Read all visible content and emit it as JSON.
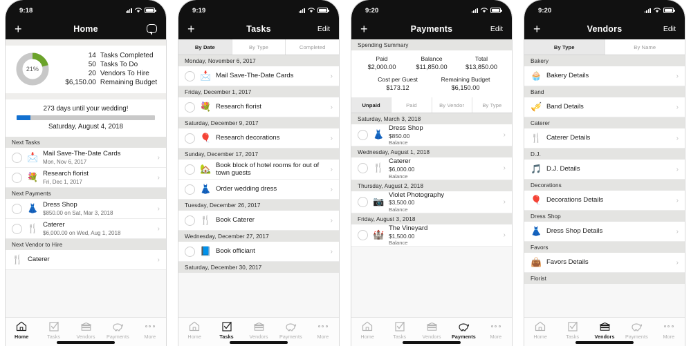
{
  "phones": [
    {
      "id": "home",
      "status": {
        "time": "9:18"
      },
      "nav": {
        "left_icon": "plus-icon",
        "title": "Home",
        "right_icon": "chat-bubble-icon"
      },
      "summary": {
        "donut_percent": "21%",
        "donut_value": 21,
        "donut_fill_color": "#6ba32a",
        "donut_track_color": "#c8c8c8",
        "stats": [
          {
            "value": "14",
            "label": "Tasks Completed"
          },
          {
            "value": "50",
            "label": "Tasks To Do"
          },
          {
            "value": "20",
            "label": "Vendors To Hire"
          },
          {
            "value": "$6,150.00",
            "label": "Remaining Budget"
          }
        ]
      },
      "countdown": {
        "title": "273 days until your wedding!",
        "progress_percent": 10,
        "progress_color": "#1270d0",
        "date": "Saturday, August 4, 2018"
      },
      "sections": [
        {
          "header": "Next Tasks",
          "rows": [
            {
              "radio": true,
              "icon": "📩",
              "icon_name": "mailbox-icon",
              "title": "Mail Save-The-Date Cards",
              "sub": "Mon, Nov 6, 2017"
            },
            {
              "radio": true,
              "icon": "💐",
              "icon_name": "bouquet-icon",
              "title": "Research florist",
              "sub": "Fri, Dec 1, 2017"
            }
          ]
        },
        {
          "header": "Next Payments",
          "rows": [
            {
              "radio": true,
              "icon": "👗",
              "icon_name": "dress-hanger-icon",
              "title": "Dress Shop",
              "sub": "$850.00 on Sat, Mar 3, 2018"
            },
            {
              "radio": true,
              "icon": "🍴",
              "icon_name": "cutlery-icon",
              "title": "Caterer",
              "sub": "$6,000.00 on Wed, Aug 1, 2018"
            }
          ]
        },
        {
          "header": "Next Vendor to Hire",
          "rows": [
            {
              "radio": false,
              "icon": "🍴",
              "icon_name": "cutlery-icon",
              "title": "Caterer",
              "sub": "",
              "clipped": true
            }
          ]
        }
      ],
      "tabbar_active": "Home"
    },
    {
      "id": "tasks",
      "status": {
        "time": "9:19"
      },
      "nav": {
        "left_icon": "plus-icon",
        "title": "Tasks",
        "right_label": "Edit"
      },
      "segments": [
        {
          "label": "By Date",
          "active": true
        },
        {
          "label": "By Type",
          "active": false
        },
        {
          "label": "Completed",
          "active": false
        }
      ],
      "sections": [
        {
          "header": "Monday, November 6, 2017",
          "rows": [
            {
              "radio": true,
              "icon": "📩",
              "icon_name": "mailbox-icon",
              "title": "Mail Save-The-Date Cards"
            }
          ]
        },
        {
          "header": "Friday, December 1, 2017",
          "rows": [
            {
              "radio": true,
              "icon": "💐",
              "icon_name": "bouquet-icon",
              "title": "Research florist"
            }
          ]
        },
        {
          "header": "Saturday, December 9, 2017",
          "rows": [
            {
              "radio": true,
              "icon": "🎈",
              "icon_name": "balloons-icon",
              "title": "Research decorations"
            }
          ]
        },
        {
          "header": "Sunday, December 17, 2017",
          "rows": [
            {
              "radio": true,
              "icon": "🏡",
              "icon_name": "house-icon",
              "title": "Book block of hotel rooms for out of town guests"
            },
            {
              "radio": true,
              "icon": "👗",
              "icon_name": "dress-hanger-icon",
              "title": "Order wedding dress"
            }
          ]
        },
        {
          "header": "Tuesday, December 26, 2017",
          "rows": [
            {
              "radio": true,
              "icon": "🍴",
              "icon_name": "cutlery-icon",
              "title": "Book Caterer"
            }
          ]
        },
        {
          "header": "Wednesday, December 27, 2017",
          "rows": [
            {
              "radio": true,
              "icon": "📘",
              "icon_name": "book-icon",
              "title": "Book officiant"
            }
          ]
        },
        {
          "header": "Saturday, December 30, 2017",
          "rows": []
        }
      ],
      "tabbar_active": "Tasks"
    },
    {
      "id": "payments",
      "status": {
        "time": "9:20"
      },
      "nav": {
        "left_icon": "plus-icon",
        "title": "Payments",
        "right_label": "Edit"
      },
      "spending": {
        "header": "Spending Summary",
        "row1": [
          {
            "label": "Paid",
            "value": "$2,000.00"
          },
          {
            "label": "Balance",
            "value": "$11,850.00"
          },
          {
            "label": "Total",
            "value": "$13,850.00"
          }
        ],
        "row2": [
          {
            "label": "Cost per Guest",
            "value": "$173.12"
          },
          {
            "label": "Remaining Budget",
            "value": "$6,150.00"
          }
        ]
      },
      "segments": [
        {
          "label": "Unpaid",
          "active": true
        },
        {
          "label": "Paid",
          "active": false
        },
        {
          "label": "By Vendor",
          "active": false
        },
        {
          "label": "By Type",
          "active": false
        }
      ],
      "sections": [
        {
          "header": "Saturday, March 3, 2018",
          "rows": [
            {
              "radio": true,
              "icon": "👗",
              "icon_name": "dress-hanger-icon",
              "title": "Dress Shop",
              "amount": "$850.00",
              "balance": "Balance"
            }
          ]
        },
        {
          "header": "Wednesday, August 1, 2018",
          "rows": [
            {
              "radio": true,
              "icon": "🍴",
              "icon_name": "cutlery-icon",
              "title": "Caterer",
              "amount": "$6,000.00",
              "balance": "Balance"
            }
          ]
        },
        {
          "header": "Thursday, August 2, 2018",
          "rows": [
            {
              "radio": true,
              "icon": "📷",
              "icon_name": "camera-icon",
              "title": "Violet Photography",
              "amount": "$3,500.00",
              "balance": "Balance"
            }
          ]
        },
        {
          "header": "Friday, August 3, 2018",
          "rows": [
            {
              "radio": true,
              "icon": "🏰",
              "icon_name": "castle-icon",
              "title": "The Vineyard",
              "amount": "$1,500.00",
              "balance": "Balance",
              "clipped": true
            }
          ]
        }
      ],
      "tabbar_active": "Payments"
    },
    {
      "id": "vendors",
      "status": {
        "time": "9:20"
      },
      "nav": {
        "left_icon": "plus-icon",
        "title": "Vendors",
        "right_label": "Edit"
      },
      "segments": [
        {
          "label": "By Type",
          "active": true
        },
        {
          "label": "By Name",
          "active": false
        }
      ],
      "sections": [
        {
          "header": "Bakery",
          "rows": [
            {
              "radio": false,
              "icon": "🧁",
              "icon_name": "cupcake-icon",
              "title": "Bakery Details"
            }
          ]
        },
        {
          "header": "Band",
          "rows": [
            {
              "radio": false,
              "icon": "🎺",
              "icon_name": "trumpet-icon",
              "title": "Band Details"
            }
          ]
        },
        {
          "header": "Caterer",
          "rows": [
            {
              "radio": false,
              "icon": "🍴",
              "icon_name": "cutlery-icon",
              "title": "Caterer Details"
            }
          ]
        },
        {
          "header": "D.J.",
          "rows": [
            {
              "radio": false,
              "icon": "🎵",
              "icon_name": "music-note-icon",
              "title": "D.J. Details"
            }
          ]
        },
        {
          "header": "Decorations",
          "rows": [
            {
              "radio": false,
              "icon": "🎈",
              "icon_name": "balloons-icon",
              "title": "Decorations Details"
            }
          ]
        },
        {
          "header": "Dress Shop",
          "rows": [
            {
              "radio": false,
              "icon": "👗",
              "icon_name": "dress-hanger-icon",
              "title": "Dress Shop Details"
            }
          ]
        },
        {
          "header": "Favors",
          "rows": [
            {
              "radio": false,
              "icon": "👜",
              "icon_name": "gift-bag-icon",
              "title": "Favors Details"
            }
          ]
        },
        {
          "header": "Florist",
          "rows": []
        }
      ],
      "tabbar_active": "Vendors"
    }
  ],
  "tabbar": {
    "items": [
      {
        "label": "Home",
        "icon_name": "home-icon"
      },
      {
        "label": "Tasks",
        "icon_name": "checklist-icon"
      },
      {
        "label": "Vendors",
        "icon_name": "store-icon"
      },
      {
        "label": "Payments",
        "icon_name": "piggy-bank-icon"
      },
      {
        "label": "More",
        "icon_name": "more-dots-icon"
      }
    ]
  },
  "chevron": "›"
}
